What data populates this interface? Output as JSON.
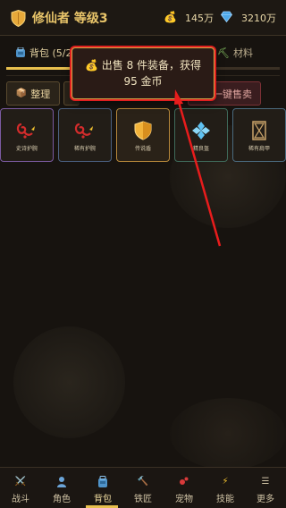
{
  "header": {
    "title": "修仙者 等级3",
    "currency": [
      {
        "icon": "money-bag-icon",
        "value": "145万"
      },
      {
        "icon": "diamond-icon",
        "value": "3210万"
      }
    ]
  },
  "tabs": {
    "bag_label": "背包 (5/2",
    "materials_label": "材料"
  },
  "actions": {
    "sort_label": "整理",
    "sell_all_label": "一键售卖"
  },
  "items": [
    {
      "name": "史诗护腕",
      "icon": "bracer-icon",
      "rarity_color": "#7a5aa0"
    },
    {
      "name": "稀有护腕",
      "icon": "bracer-icon",
      "rarity_color": "#4a5f7f"
    },
    {
      "name": "传说盾",
      "icon": "shield-icon",
      "rarity_color": "#b8893a"
    },
    {
      "name": "精良盔",
      "icon": "gem-icon",
      "rarity_color": "#3f6a5a"
    },
    {
      "name": "稀有肩甲",
      "icon": "hourglass-icon",
      "rarity_color": "#4a6a7e"
    }
  ],
  "toast": {
    "icon": "money-bag-icon",
    "message": "出售 8 件装备，获得 95 金币"
  },
  "nav": [
    {
      "label": "战斗",
      "icon": "crossed-swords-icon",
      "active": false
    },
    {
      "label": "角色",
      "icon": "person-icon",
      "active": false
    },
    {
      "label": "背包",
      "icon": "backpack-icon",
      "active": true
    },
    {
      "label": "铁匠",
      "icon": "hammer-icon",
      "active": false
    },
    {
      "label": "宠物",
      "icon": "pet-icon",
      "active": false
    },
    {
      "label": "技能",
      "icon": "lightning-icon",
      "active": false
    },
    {
      "label": "更多",
      "icon": "menu-icon",
      "active": false
    }
  ],
  "colors": {
    "accent_gold": "#e9c56a",
    "alert_red": "#e01f1f"
  }
}
